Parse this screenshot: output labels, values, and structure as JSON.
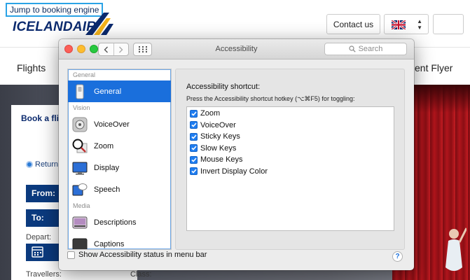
{
  "website": {
    "skip_link": "Jump to booking engine",
    "logo_text": "ICELANDAIR",
    "contact_label": "Contact us",
    "language_flag": "uk-flag",
    "nav": {
      "flights": "Flights",
      "frequent_flyer_partial": "ent Flyer"
    },
    "booking": {
      "title_partial": "Book a flig",
      "return_label": "Return",
      "from_label": "From:",
      "to_label": "To:",
      "depart_label": "Depart:",
      "travellers_label": "Travellers:",
      "class_label": "Class:"
    }
  },
  "window": {
    "title": "Accessibility",
    "search_placeholder": "Search",
    "sidebar": {
      "sections": [
        {
          "header": "General",
          "items": [
            {
              "label": "General",
              "icon": "general-switch-icon",
              "selected": true
            }
          ]
        },
        {
          "header": "Vision",
          "items": [
            {
              "label": "VoiceOver",
              "icon": "voiceover-icon",
              "selected": false
            },
            {
              "label": "Zoom",
              "icon": "zoom-magnifier-icon",
              "selected": false
            },
            {
              "label": "Display",
              "icon": "display-monitor-icon",
              "selected": false
            },
            {
              "label": "Speech",
              "icon": "speech-bubble-icon",
              "selected": false
            }
          ]
        },
        {
          "header": "Media",
          "items": [
            {
              "label": "Descriptions",
              "icon": "descriptions-icon",
              "selected": false
            },
            {
              "label": "Captions",
              "icon": "captions-icon",
              "selected": false
            }
          ]
        }
      ]
    },
    "content": {
      "title": "Accessibility shortcut:",
      "description": "Press the Accessibility shortcut hotkey (⌥⌘F5) for toggling:",
      "options": [
        {
          "label": "Zoom",
          "checked": true
        },
        {
          "label": "VoiceOver",
          "checked": true
        },
        {
          "label": "Sticky Keys",
          "checked": true
        },
        {
          "label": "Slow Keys",
          "checked": true
        },
        {
          "label": "Mouse Keys",
          "checked": true
        },
        {
          "label": "Invert Display Color",
          "checked": true
        }
      ]
    },
    "footer": {
      "show_status_label": "Show Accessibility status in menu bar",
      "show_status_checked": false,
      "help_label": "?"
    }
  },
  "colors": {
    "accent": "#1a6fdc",
    "checkbox": "#1f7df0",
    "brand_navy": "#0b2a6e"
  }
}
